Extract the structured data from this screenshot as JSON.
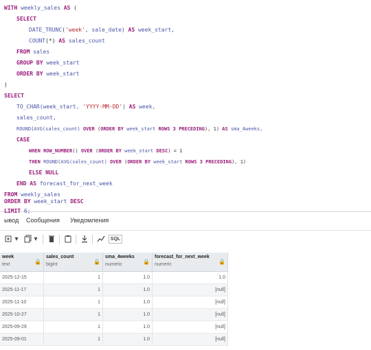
{
  "editor": {
    "l1": {
      "k1": "WITH",
      "t1": " weekly_sales ",
      "k2": "AS",
      "t2": " ("
    },
    "l2": {
      "k1": "SELECT"
    },
    "l3": {
      "f1": "DATE_TRUNC",
      "t1": "(",
      "s1": "'week'",
      "t2": ", sale_date) ",
      "k1": "AS",
      "t3": " week_start,"
    },
    "l4": {
      "f1": "COUNT",
      "t1": "(*) ",
      "k1": "AS",
      "t2": " sales_count"
    },
    "l5": {
      "k1": "FROM",
      "t1": " sales"
    },
    "l6": {
      "k1": "GROUP BY",
      "t1": " week_start"
    },
    "l7": {
      "k1": "ORDER BY",
      "t1": " week_start"
    },
    "l8": {
      "t1": ")"
    },
    "l9": {
      "k1": "SELECT"
    },
    "l10": {
      "f1": "TO_CHAR",
      "t1": "(week_start, ",
      "s1": "'YYYY-MM-DD'",
      "t2": ") ",
      "k1": "AS",
      "t3": " week,"
    },
    "l11": {
      "t1": "sales_count,"
    },
    "l12": {
      "f1": "ROUND",
      "t1": "(",
      "f2": "AVG",
      "t2": "(sales_count) ",
      "k1": "OVER",
      "t3": " (",
      "k2": "ORDER BY",
      "t4": " week_start ",
      "k3": "ROWS 3 PRECEDING",
      "t5": "), 1) ",
      "k4": "AS",
      "t6": " sma_4weeks,"
    },
    "l13": {
      "k1": "CASE"
    },
    "l14": {
      "k1": "WHEN",
      "t1": " ",
      "f1": "ROW_NUMBER",
      "t2": "() ",
      "k2": "OVER",
      "t3": " (",
      "k3": "ORDER BY",
      "t4": " week_start ",
      "k4": "DESC",
      "t5": ") = 1"
    },
    "l15": {
      "k1": "THEN",
      "t1": " ",
      "f1": "ROUND",
      "t2": "(",
      "f2": "AVG",
      "t3": "(sales_count) ",
      "k2": "OVER",
      "t4": " (",
      "k3": "ORDER BY",
      "t5": " week_start ",
      "k4": "ROWS 3 PRECEDING",
      "t6": "), 1)"
    },
    "l16": {
      "k1": "ELSE NULL"
    },
    "l17": {
      "k1": "END AS",
      "t1": " forecast_for_next_week"
    },
    "l18": {
      "k1": "FROM",
      "t1": " weekly_sales"
    },
    "l19": {
      "k1": "ORDER BY",
      "t1": " week_start ",
      "k2": "DESC"
    },
    "l20": {
      "k1": "LIMIT",
      "t1": " 6;"
    }
  },
  "tabs": {
    "output": "ывод",
    "messages": "Сообщения",
    "notifications": "Уведомления"
  },
  "toolbar_icons": [
    "add-row-icon",
    "dropdown-icon",
    "copy-icon",
    "dropdown-icon",
    "delete-icon",
    "paste-icon",
    "download-icon",
    "graph-icon",
    "sql-icon"
  ],
  "sql_label": "SQL",
  "columns": [
    {
      "name": "week",
      "type": "text"
    },
    {
      "name": "sales_count",
      "type": "bigint"
    },
    {
      "name": "sma_4weeks",
      "type": "numeric"
    },
    {
      "name": "forecast_for_next_week",
      "type": "numeric"
    }
  ],
  "rows": [
    [
      "2025-12-15",
      "1",
      "1.0",
      "1.0"
    ],
    [
      "2025-11-17",
      "1",
      "1.0",
      "[null]"
    ],
    [
      "2025-11-10",
      "1",
      "1.0",
      "[null]"
    ],
    [
      "2025-10-27",
      "1",
      "1.0",
      "[null]"
    ],
    [
      "2025-09-29",
      "1",
      "1.0",
      "[null]"
    ],
    [
      "2025-09-01",
      "1",
      "1.0",
      "[null]"
    ]
  ]
}
